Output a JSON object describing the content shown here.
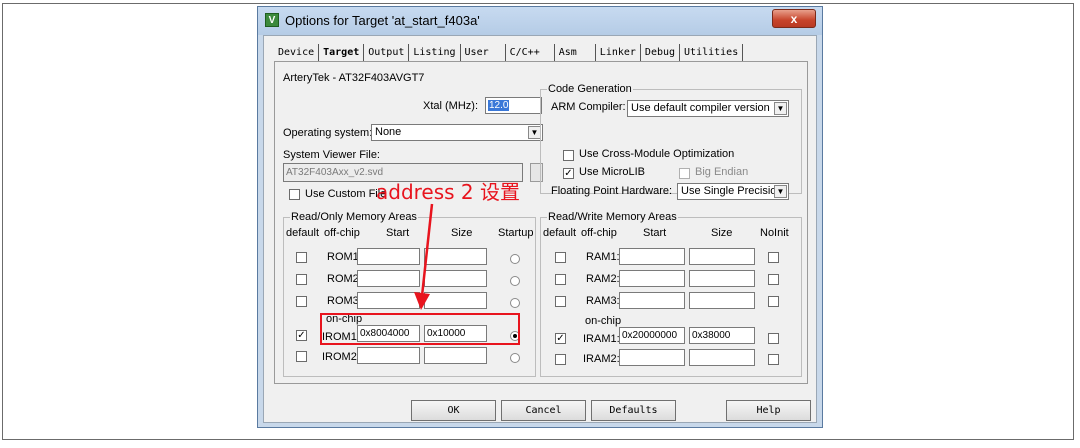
{
  "window": {
    "title": "Options for Target 'at_start_f403a'",
    "close_glyph": "x",
    "app_icon_glyph": "V"
  },
  "tabs": [
    {
      "label": "Device",
      "active": false
    },
    {
      "label": "Target",
      "active": true
    },
    {
      "label": "Output",
      "active": false
    },
    {
      "label": "Listing",
      "active": false
    },
    {
      "label": "User",
      "active": false
    },
    {
      "label": "C/C++",
      "active": false
    },
    {
      "label": "Asm",
      "active": false
    },
    {
      "label": "Linker",
      "active": false
    },
    {
      "label": "Debug",
      "active": false
    },
    {
      "label": "Utilities",
      "active": false
    }
  ],
  "target": {
    "device_name": "ArteryTek - AT32F403AVGT7",
    "xtal_label": "Xtal (MHz):",
    "xtal_value": "12.0",
    "os_label": "Operating system:",
    "os_value": "None",
    "svf_label": "System Viewer File:",
    "svf_value": "AT32F403Axx_v2.svd",
    "custom_file_label": "Use Custom File"
  },
  "codegen": {
    "title": "Code Generation",
    "compiler_label": "ARM Compiler:",
    "compiler_value": "Use default compiler version",
    "cross_module_label": "Use Cross-Module Optimization",
    "microlib_label": "Use MicroLIB",
    "big_endian_label": "Big Endian",
    "fpu_label": "Floating Point Hardware:",
    "fpu_value": "Use Single Precision"
  },
  "rom": {
    "title": "Read/Only Memory Areas",
    "headers": {
      "default": "default",
      "offchip": "off-chip",
      "start": "Start",
      "size": "Size",
      "startup": "Startup"
    },
    "onchip_label": "on-chip",
    "rows": [
      {
        "name": "ROM1:",
        "start": "",
        "size": "",
        "checked": false,
        "startup": false
      },
      {
        "name": "ROM2:",
        "start": "",
        "size": "",
        "checked": false,
        "startup": false
      },
      {
        "name": "ROM3:",
        "start": "",
        "size": "",
        "checked": false,
        "startup": false
      },
      {
        "name": "IROM1:",
        "start": "0x8004000",
        "size": "0x10000",
        "checked": true,
        "startup": true
      },
      {
        "name": "IROM2:",
        "start": "",
        "size": "",
        "checked": false,
        "startup": false
      }
    ]
  },
  "ram": {
    "title": "Read/Write Memory Areas",
    "headers": {
      "default": "default",
      "offchip": "off-chip",
      "start": "Start",
      "size": "Size",
      "noinit": "NoInit"
    },
    "onchip_label": "on-chip",
    "rows": [
      {
        "name": "RAM1:",
        "start": "",
        "size": "",
        "checked": false,
        "noinit": false
      },
      {
        "name": "RAM2:",
        "start": "",
        "size": "",
        "checked": false,
        "noinit": false
      },
      {
        "name": "RAM3:",
        "start": "",
        "size": "",
        "checked": false,
        "noinit": false
      },
      {
        "name": "IRAM1:",
        "start": "0x20000000",
        "size": "0x38000",
        "checked": true,
        "noinit": false
      },
      {
        "name": "IRAM2:",
        "start": "",
        "size": "",
        "checked": false,
        "noinit": false
      }
    ]
  },
  "buttons": {
    "ok": "OK",
    "cancel": "Cancel",
    "defaults": "Defaults",
    "help": "Help"
  },
  "annotation": {
    "text": "address 2 设置",
    "color": "#e8141e"
  },
  "glyphs": {
    "check": "✓",
    "dropdown": "▼"
  }
}
